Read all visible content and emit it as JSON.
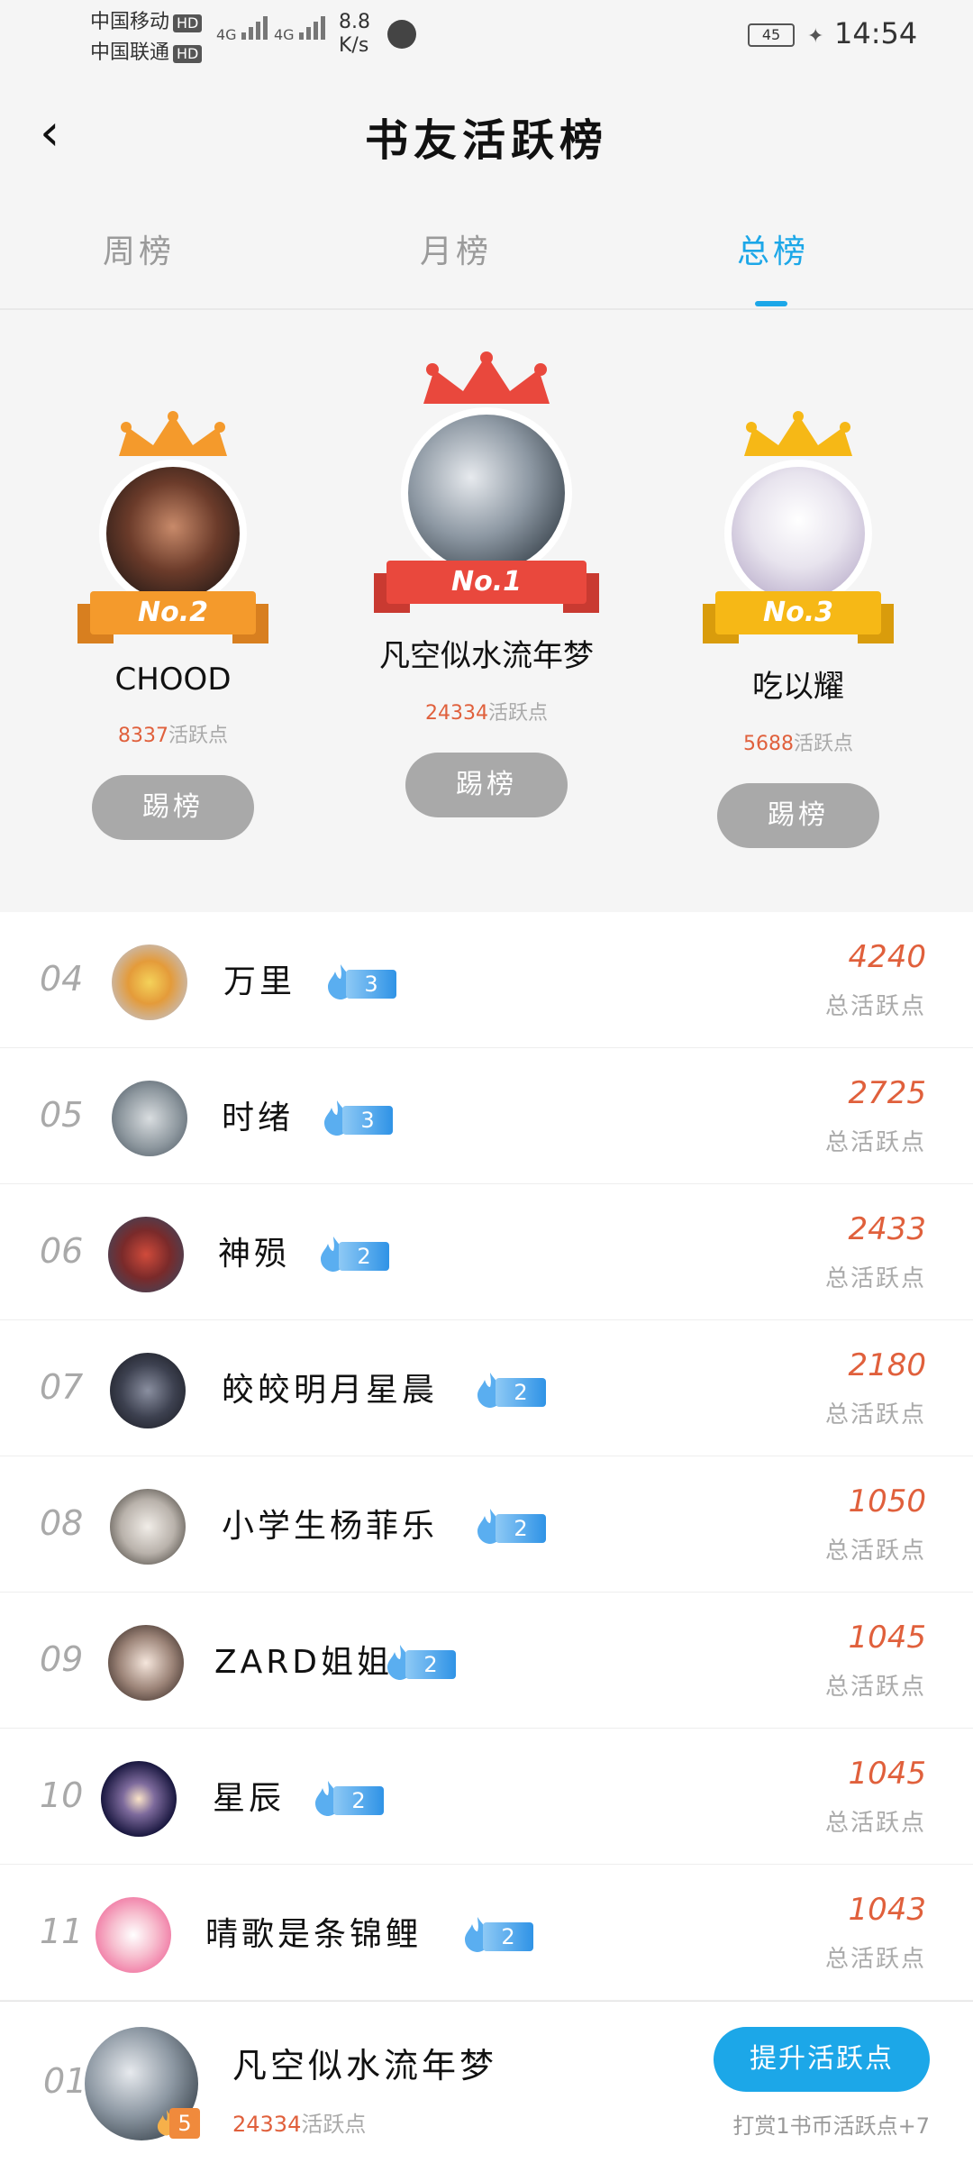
{
  "status_bar": {
    "carrier1": "中国移动",
    "carrier2": "中国联通",
    "hd": "HD",
    "net1": "4G",
    "net2": "4G",
    "speed_value": "8.8",
    "speed_unit": "K/s",
    "battery": "45",
    "time": "14:54",
    "icons": [
      "signal-icon",
      "globe-icon",
      "battery-icon",
      "leaf-icon"
    ]
  },
  "header": {
    "title": "书友活跃榜",
    "back_icon": "back-chevron-icon"
  },
  "tabs": [
    {
      "label": "周榜",
      "active": false
    },
    {
      "label": "月榜",
      "active": false
    },
    {
      "label": "总榜",
      "active": true
    }
  ],
  "podium": {
    "kick_label": "踢榜",
    "points_suffix": "活跃点",
    "second": {
      "badge": "No.2",
      "name": "CHOOD",
      "points": "8337"
    },
    "first": {
      "badge": "No.1",
      "name": "凡空似水流年梦",
      "points": "24334"
    },
    "third": {
      "badge": "No.3",
      "name": "吃以耀",
      "points": "5688"
    }
  },
  "list": {
    "score_label": "总活跃点",
    "rows": [
      {
        "rank": "04",
        "name": "万里",
        "level": "3",
        "score": "4240"
      },
      {
        "rank": "05",
        "name": "时绪",
        "level": "3",
        "score": "2725"
      },
      {
        "rank": "06",
        "name": "神殒",
        "level": "2",
        "score": "2433"
      },
      {
        "rank": "07",
        "name": "皎皎明月星晨",
        "level": "2",
        "score": "2180"
      },
      {
        "rank": "08",
        "name": "小学生杨菲乐",
        "level": "2",
        "score": "1050"
      },
      {
        "rank": "09",
        "name": "ZARD姐姐",
        "level": "2",
        "score": "1045"
      },
      {
        "rank": "10",
        "name": "星辰",
        "level": "2",
        "score": "1045"
      },
      {
        "rank": "11",
        "name": "晴歌是条锦鲤",
        "level": "2",
        "score": "1043"
      }
    ]
  },
  "my_bar": {
    "rank": "01",
    "name": "凡空似水流年梦",
    "level": "5",
    "points": "24334",
    "points_suffix": "活跃点",
    "boost_label": "提升活跃点",
    "tip": "打赏1书币活跃点+7"
  },
  "colors": {
    "accent": "#1ca7e8",
    "score": "#e0603c",
    "gold": "#f6b816",
    "orange": "#f49a2c",
    "red": "#e9483d"
  }
}
